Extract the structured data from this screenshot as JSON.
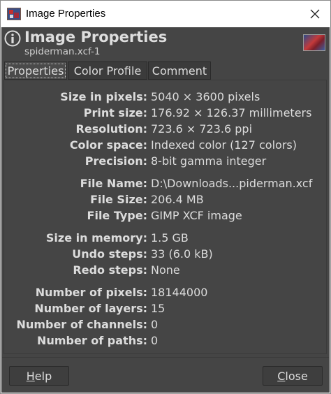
{
  "window": {
    "title": "Image Properties"
  },
  "header": {
    "title": "Image Properties",
    "subtitle": "spiderman.xcf-1"
  },
  "tabs": [
    {
      "label": "Properties",
      "active": true
    },
    {
      "label": "Color Profile",
      "active": false
    },
    {
      "label": "Comment",
      "active": false
    }
  ],
  "properties": {
    "size_in_pixels": {
      "label": "Size in pixels:",
      "value": "5040 × 3600 pixels"
    },
    "print_size": {
      "label": "Print size:",
      "value": "176.92 × 126.37 millimeters"
    },
    "resolution": {
      "label": "Resolution:",
      "value": "723.6 × 723.6 ppi"
    },
    "color_space": {
      "label": "Color space:",
      "value": "Indexed color (127 colors)"
    },
    "precision": {
      "label": "Precision:",
      "value": "8-bit gamma integer"
    },
    "file_name": {
      "label": "File Name:",
      "value": "D:\\Downloads...piderman.xcf"
    },
    "file_size": {
      "label": "File Size:",
      "value": "206.4 MB"
    },
    "file_type": {
      "label": "File Type:",
      "value": "GIMP XCF image"
    },
    "size_in_memory": {
      "label": "Size in memory:",
      "value": "1.5 GB"
    },
    "undo_steps": {
      "label": "Undo steps:",
      "value": "33 (6.0 kB)"
    },
    "redo_steps": {
      "label": "Redo steps:",
      "value": "None"
    },
    "number_of_pixels": {
      "label": "Number of pixels:",
      "value": "18144000"
    },
    "number_of_layers": {
      "label": "Number of layers:",
      "value": "15"
    },
    "number_of_channels": {
      "label": "Number of channels:",
      "value": "0"
    },
    "number_of_paths": {
      "label": "Number of paths:",
      "value": "0"
    }
  },
  "buttons": {
    "help": {
      "mnemonic": "H",
      "rest": "elp"
    },
    "close": {
      "mnemonic": "C",
      "rest": "lose"
    }
  },
  "icons": {
    "app": "gimp-app-icon",
    "close": "close-icon",
    "info": "info-icon",
    "thumbnail": "image-thumbnail"
  },
  "colors": {
    "dialog_bg": "#454545",
    "text": "#dcdcdc"
  }
}
